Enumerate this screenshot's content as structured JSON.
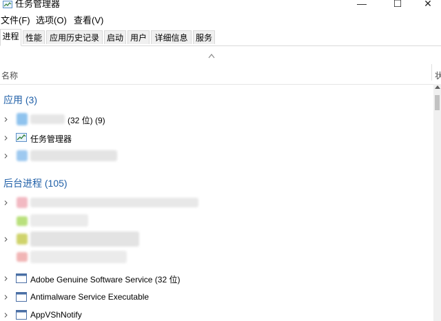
{
  "window": {
    "title": "任务管理器",
    "minimize": "—",
    "maximize": "☐",
    "close": "✕"
  },
  "menu": [
    "文件(F)",
    "选项(O)",
    "查看(V)"
  ],
  "tabs": [
    "进程",
    "性能",
    "应用历史记录",
    "启动",
    "用户",
    "详细信息",
    "服务"
  ],
  "columns": {
    "name": "名称",
    "truncated": "状"
  },
  "groups": {
    "apps": "应用 (3)",
    "background": "后台进程 (105)"
  },
  "apps": [
    {
      "label": "(32 位) (9)",
      "icon": "blurred-app-icon",
      "blurred": true
    },
    {
      "label": "任务管理器",
      "icon": "task-manager-icon"
    },
    {
      "label": "",
      "icon": "blurred-app-icon",
      "blurred": true
    }
  ],
  "background": [
    {
      "label": "Adobe Genuine Software Service (32 位)",
      "icon": "service-window-icon"
    },
    {
      "label": "Antimalware Service Executable",
      "icon": "service-window-icon"
    },
    {
      "label": "AppVShNotify",
      "icon": "service-window-icon"
    }
  ],
  "colors": {
    "group": "#1f5fa7",
    "tabBg": "#f0f0f0"
  }
}
